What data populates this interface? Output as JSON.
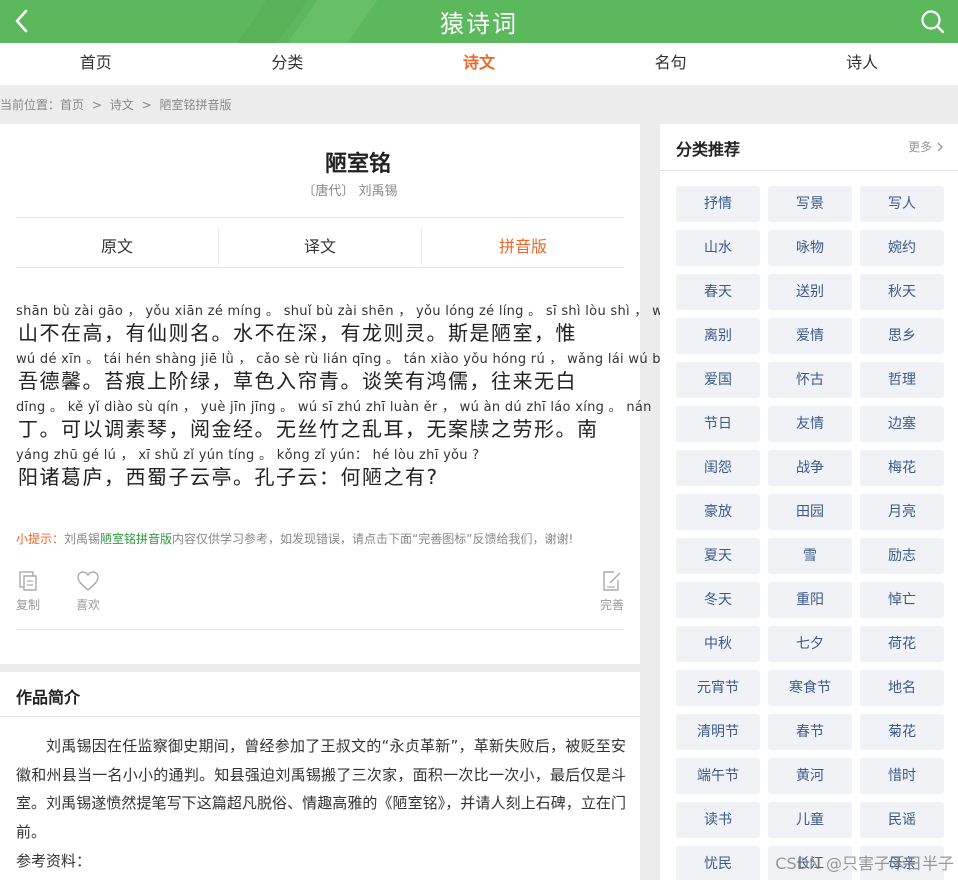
{
  "header": {
    "logo": "猿诗词"
  },
  "nav": [
    "首页",
    "分类",
    "诗文",
    "名句",
    "诗人"
  ],
  "breadcrumb": {
    "prefix": "当前位置：",
    "items": [
      "首页",
      ">",
      "诗文",
      ">",
      "陋室铭拼音版"
    ]
  },
  "poem": {
    "title": "陋室铭",
    "author": "〔唐代〕 刘禹锡",
    "tabs": [
      "原文",
      "译文",
      "拼音版"
    ],
    "lines": [
      {
        "py": "shān bù zài gāo ，  yǒu xiān zé míng 。 shuǐ bù zài shēn ，  yǒu lóng zé líng 。  sī shì lòu shì ，  wéi",
        "hz": "山不在高，有仙则名。水不在深，有龙则灵。斯是陋室，惟"
      },
      {
        "py": "wú dé xīn 。  tái hén shàng jiē  lǜ ，  cǎo sè rù lián qīng 。 tán xiào yǒu hóng rú ，  wǎng lái wú bái",
        "hz": "吾德馨。苔痕上阶绿，草色入帘青。谈笑有鸿儒，往来无白"
      },
      {
        "py": "dīng 。  kě yǐ diào sù qín ，  yuè jīn jīng 。  wú sī zhú zhī luàn ěr ，  wú àn dú zhī láo xíng 。  nán",
        "hz": "丁。可以调素琴，阅金经。无丝竹之乱耳，无案牍之劳形。南"
      },
      {
        "py": "yáng zhū gé  lú ，   xī shǔ zǐ yún tíng 。 kǒng zǐ yún：   hé lòu zhī yǒu ?",
        "hz": "阳诸葛庐，西蜀子云亭。孔子云：何陋之有?"
      }
    ],
    "tip": {
      "label": "小提示：",
      "pre": "刘禹锡",
      "link": "陋室铭拼音版",
      "post": "内容仅供学习参考，如发现错误，请点击下面“完善图标”反馈给我们，谢谢!"
    },
    "tools": {
      "copy": "复制",
      "like": "喜欢",
      "improve": "完善"
    }
  },
  "intro": {
    "heading": "作品简介",
    "text": "刘禹锡因在任监察御史期间，曾经参加了王叔文的“永贞革新”，革新失败后，被贬至安徽和州县当一名小小的通判。知县强迫刘禹锡搬了三次家，面积一次比一次小，最后仅是斗室。刘禹锡遂愤然提笔写下这篇超凡脱俗、情趣高雅的《陋室铭》，并请人刻上石碑，立在门前。",
    "ref": "参考资料："
  },
  "sidebar": {
    "heading": "分类推荐",
    "more": "更多",
    "tags": [
      "抒情",
      "写景",
      "写人",
      "山水",
      "咏物",
      "婉约",
      "春天",
      "送别",
      "秋天",
      "离别",
      "爱情",
      "思乡",
      "爱国",
      "怀古",
      "哲理",
      "节日",
      "友情",
      "边塞",
      "闺怨",
      "战争",
      "梅花",
      "豪放",
      "田园",
      "月亮",
      "夏天",
      "雪",
      "励志",
      "冬天",
      "重阳",
      "悼亡",
      "中秋",
      "七夕",
      "荷花",
      "元宵节",
      "寒食节",
      "地名",
      "清明节",
      "春节",
      "菊花",
      "端午节",
      "黄河",
      "惜时",
      "读书",
      "儿童",
      "民谣",
      "忧民",
      "长江",
      "母亲"
    ]
  },
  "watermark": "CSDN @只害子禾日半子",
  "colors": {
    "brand": "#5cb85c",
    "accent": "#e8682b",
    "tag_text": "#3a5a8c"
  }
}
